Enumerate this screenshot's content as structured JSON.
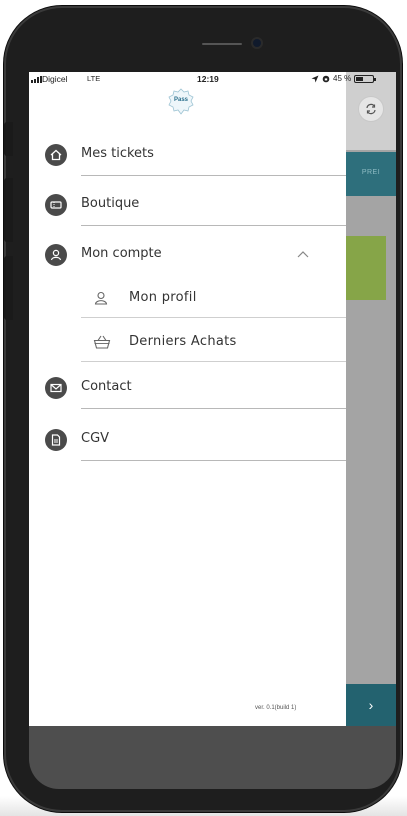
{
  "status_bar": {
    "carrier": "Digicel",
    "network": "LTE",
    "time": "12:19",
    "battery_percent": "45 %",
    "battery_level": 0.45
  },
  "app": {
    "logo_text": "Pass"
  },
  "menu": {
    "items": [
      {
        "label": "Mes tickets",
        "icon": "home-icon"
      },
      {
        "label": "Boutique",
        "icon": "ticket-icon"
      },
      {
        "label": "Mon compte",
        "icon": "user-icon",
        "expanded": true
      },
      {
        "label": "Contact",
        "icon": "mail-icon"
      },
      {
        "label": "CGV",
        "icon": "document-icon"
      }
    ],
    "subitems": [
      {
        "label": "Mon profil",
        "icon": "user-outline-icon"
      },
      {
        "label": "Derniers Achats",
        "icon": "basket-icon"
      }
    ]
  },
  "footer": {
    "version": "ver. 0.1(build 1)"
  },
  "background_app": {
    "banner_text": "PREI",
    "next_label": "›"
  },
  "colors": {
    "icon_circle": "#4a4a4a",
    "teal": "#2e6f7c",
    "green": "#86a548",
    "scrim": "#a4a4a4"
  }
}
